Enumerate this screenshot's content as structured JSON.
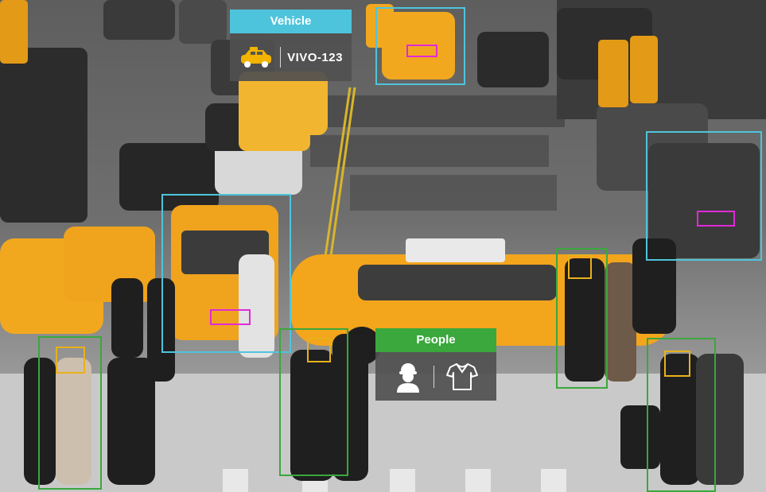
{
  "vehicle_panel": {
    "title": "Vehicle",
    "plate": "VIVO-123",
    "icon": "taxi-icon",
    "header_color": "#4ec4dc"
  },
  "people_panel": {
    "title": "People",
    "icons": [
      "person-icon",
      "shirt-icon"
    ],
    "header_color": "#3aa83c"
  },
  "detection_colors": {
    "vehicle": "#4ec4dc",
    "person": "#3aa83c",
    "license_plate": "#e02ad8",
    "face": "#e9b11a"
  }
}
